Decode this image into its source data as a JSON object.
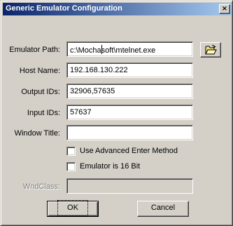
{
  "window": {
    "title": "Generic Emulator Configuration"
  },
  "fields": {
    "emulator_path": {
      "label": "Emulator Path:",
      "value_before_caret": "c:\\Mocha",
      "value_after_caret": "soft\\mtelnet.exe"
    },
    "host_name": {
      "label": "Host Name:",
      "value": "192.168.130.222"
    },
    "output_ids": {
      "label": "Output IDs:",
      "value": "32906,57635"
    },
    "input_ids": {
      "label": "Input IDs:",
      "value": "57637"
    },
    "window_title": {
      "label": "Window Title:",
      "value": ""
    },
    "wndclass": {
      "label": "WndClass:",
      "value": ""
    }
  },
  "checkboxes": {
    "advanced_enter": {
      "label": "Use Advanced Enter Method",
      "checked": false
    },
    "emulator_16bit": {
      "label": "Emulator is 16 Bit",
      "checked": false
    }
  },
  "buttons": {
    "ok": "OK",
    "cancel": "Cancel",
    "browse_icon": "open-folder-icon",
    "close_icon": "close-icon"
  },
  "colors": {
    "title_start": "#0a246a",
    "title_end": "#a6caf0",
    "face": "#d4d0c8",
    "disabled_text": "#808080"
  }
}
